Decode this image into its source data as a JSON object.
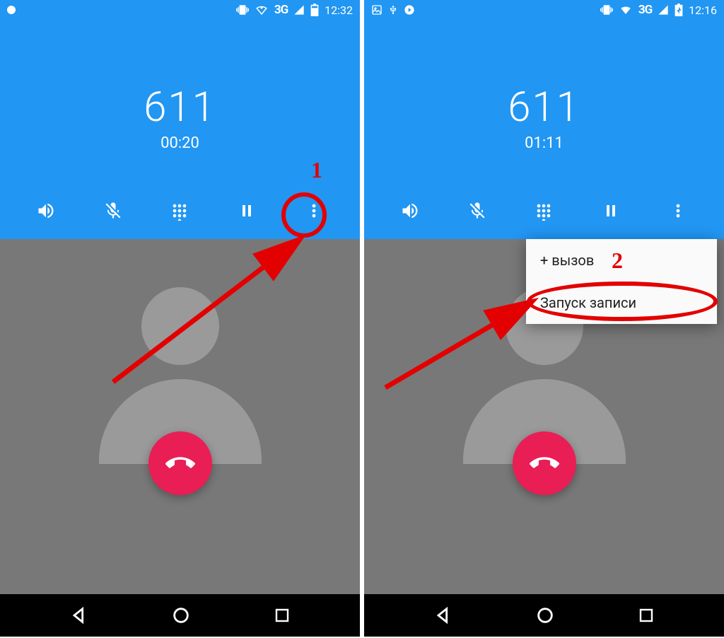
{
  "screens": {
    "left": {
      "statusbar": {
        "time": "12:32",
        "network_label": "3G"
      },
      "call": {
        "number": "611",
        "duration": "00:20"
      },
      "annotation": {
        "label": "1"
      }
    },
    "right": {
      "statusbar": {
        "time": "12:16",
        "network_label": "3G"
      },
      "call": {
        "number": "611",
        "duration": "01:11"
      },
      "menu": {
        "add_call": "+ вызов",
        "start_recording": "Запуск записи"
      },
      "annotation": {
        "label": "2"
      }
    }
  }
}
